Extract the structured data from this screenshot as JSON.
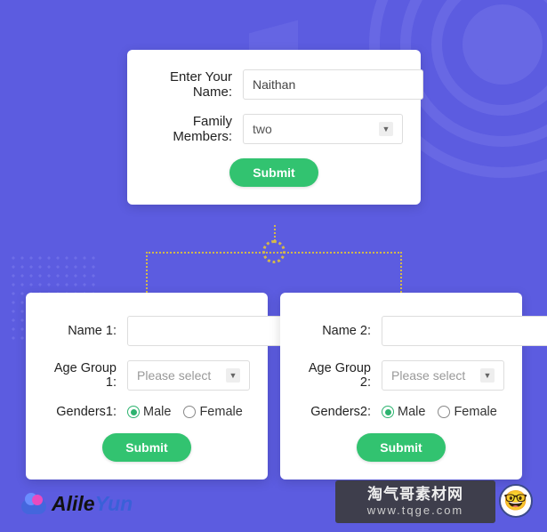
{
  "main": {
    "name_label": "Enter Your Name:",
    "name_value": "Naithan",
    "family_label": "Family Members:",
    "family_value": "two",
    "submit": "Submit"
  },
  "member1": {
    "name_label": "Name 1:",
    "name_value": "",
    "age_label": "Age Group 1:",
    "age_placeholder": "Please select",
    "gender_label": "Genders1:",
    "male": "Male",
    "female": "Female",
    "submit": "Submit"
  },
  "member2": {
    "name_label": "Name 2:",
    "name_value": "",
    "age_label": "Age Group 2:",
    "age_placeholder": "Please select",
    "gender_label": "Genders2:",
    "male": "Male",
    "female": "Female",
    "submit": "Submit"
  },
  "logo": {
    "part1": "Alile",
    "part2": "Yun"
  },
  "watermark": {
    "line1": "淘气哥素材网",
    "line2": "www.tqge.com"
  },
  "emoji": "🤓"
}
